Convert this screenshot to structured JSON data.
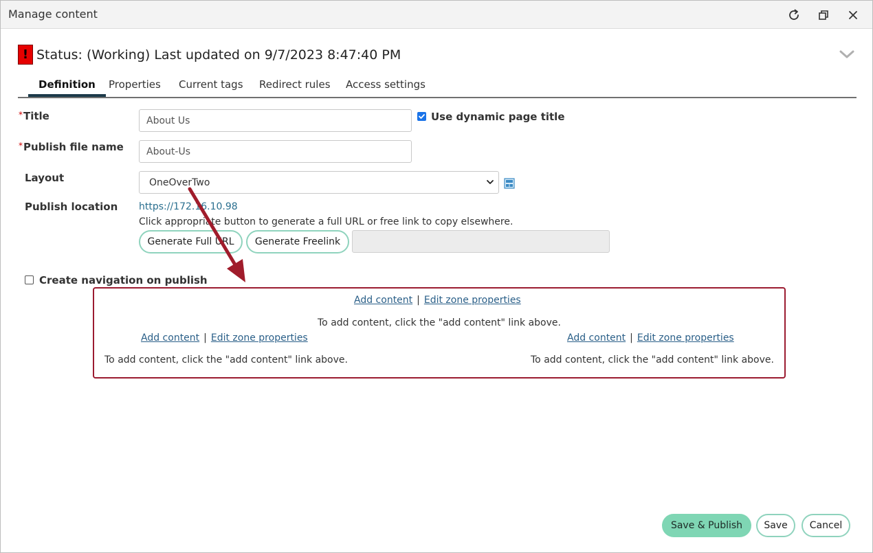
{
  "window": {
    "title": "Manage content",
    "icons": [
      "refresh-icon",
      "restore-icon",
      "close-icon"
    ]
  },
  "status": {
    "flag": "!",
    "text": "Status: (Working) Last updated on 9/7/2023 8:47:40 PM",
    "flag_color": "#e60000"
  },
  "tabs": [
    {
      "label": "Definition",
      "active": true
    },
    {
      "label": "Properties",
      "active": false
    },
    {
      "label": "Current tags",
      "active": false
    },
    {
      "label": "Redirect rules",
      "active": false
    },
    {
      "label": "Access settings",
      "active": false
    }
  ],
  "form": {
    "required_mark": "*",
    "title_label": "Title",
    "title_value": "About Us",
    "dynamic_title_label": "Use dynamic page title",
    "dynamic_title_checked": true,
    "file_name_label": "Publish file name",
    "file_name_value": "About-Us",
    "layout_label": "Layout",
    "layout_value": "OneOverTwo",
    "location_label": "Publish location",
    "location_url": "https://172.16.10.98",
    "location_hint": "Click appropriate button to generate a full URL or free link to copy elsewhere.",
    "gen_full_url": "Generate Full URL",
    "gen_freelink": "Generate Freelink",
    "nav_label": "Create navigation on publish",
    "nav_checked": false
  },
  "zones": {
    "add_content": "Add content",
    "separator": "|",
    "edit_zone": "Edit zone properties",
    "hint": "To add content, click the \"add content\" link above."
  },
  "footer": {
    "save_publish": "Save & Publish",
    "save": "Save",
    "cancel": "Cancel"
  },
  "colors": {
    "accent": "#7fd6b4",
    "link": "#2a6f8f",
    "zone_border": "#9b1b30",
    "annotation_arrow": "#a01c2b"
  }
}
